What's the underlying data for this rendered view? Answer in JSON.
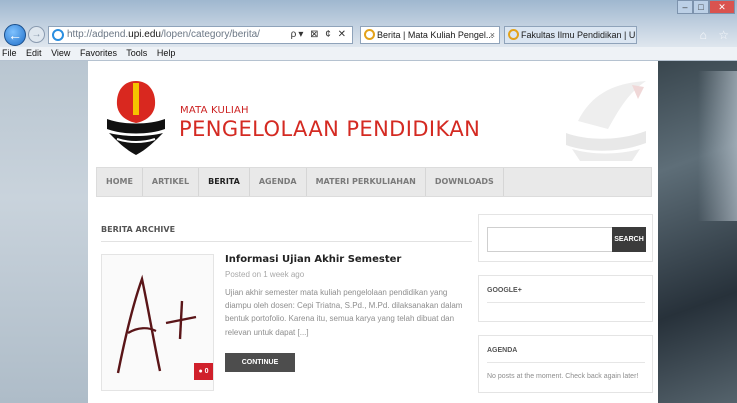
{
  "browser": {
    "back": "←",
    "forward": "→",
    "address_prefix": "http://adpend.",
    "address_domain": "upi.edu",
    "address_suffix": "/lopen/category/berita/",
    "address_tools": "ρ▾ ⊠ ¢ ✕",
    "tabs": [
      {
        "label": "Berita | Mata Kuliah Pengel...",
        "close": "×"
      },
      {
        "label": "Fakultas Ilmu Pendidikan | Uni..."
      }
    ],
    "window_buttons": [
      "–",
      "□",
      "✕"
    ],
    "home_star": "⌂ ☆",
    "menu": [
      "File",
      "Edit",
      "View",
      "Favorites",
      "Tools",
      "Help"
    ]
  },
  "site": {
    "title_small": "MATA KULIAH",
    "title_big": "PENGELOLAAN PENDIDIKAN"
  },
  "nav": [
    "HOME",
    "ARTIKEL",
    "BERITA",
    "AGENDA",
    "MATERI PERKULIAHAN",
    "DOWNLOADS"
  ],
  "nav_active": "BERITA",
  "archive": {
    "title": "BERITA ARCHIVE"
  },
  "post": {
    "thumbnail_text": "A+",
    "comment_count": "0",
    "title": "Informasi Ujian Akhir Semester",
    "meta": "Posted on 1 week ago",
    "excerpt": "Ujian akhir semester mata kuliah pengelolaan pendidikan yang diampu oleh dosen: Cepi Triatna, S.Pd., M.Pd. dilaksanakan dalam bentuk portofolio. Karena itu, semua karya yang telah dibuat dan relevan untuk dapat [...]",
    "read_more": "CONTINUE READING"
  },
  "sidebar": {
    "search_button": "SEARCH",
    "google_title": "GOOGLE+",
    "agenda_title": "AGENDA",
    "agenda_text": "No posts at the moment. Check back again later!"
  },
  "colors": {
    "brand_red": "#d42a22",
    "logo_yellow": "#f5c400",
    "nav_bg": "#e9e9e9"
  }
}
